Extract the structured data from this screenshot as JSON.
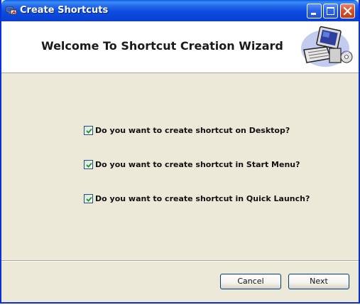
{
  "window": {
    "title": "Create Shortcuts"
  },
  "header": {
    "title": "Welcome To Shortcut Creation Wizard",
    "graphic_icon": "computer-with-disc-icon"
  },
  "options": [
    {
      "label": "Do you want to create shortcut on Desktop?",
      "checked": true
    },
    {
      "label": "Do you want to create shortcut in Start Menu?",
      "checked": true
    },
    {
      "label": "Do you want to create shortcut in Quick Launch?",
      "checked": true
    }
  ],
  "buttons": {
    "cancel": "Cancel",
    "next": "Next"
  },
  "colors": {
    "titlebar": "#0a44d8",
    "dialog_bg": "#ece9d8",
    "checkmark": "#21a121",
    "close_button": "#d9502c"
  }
}
